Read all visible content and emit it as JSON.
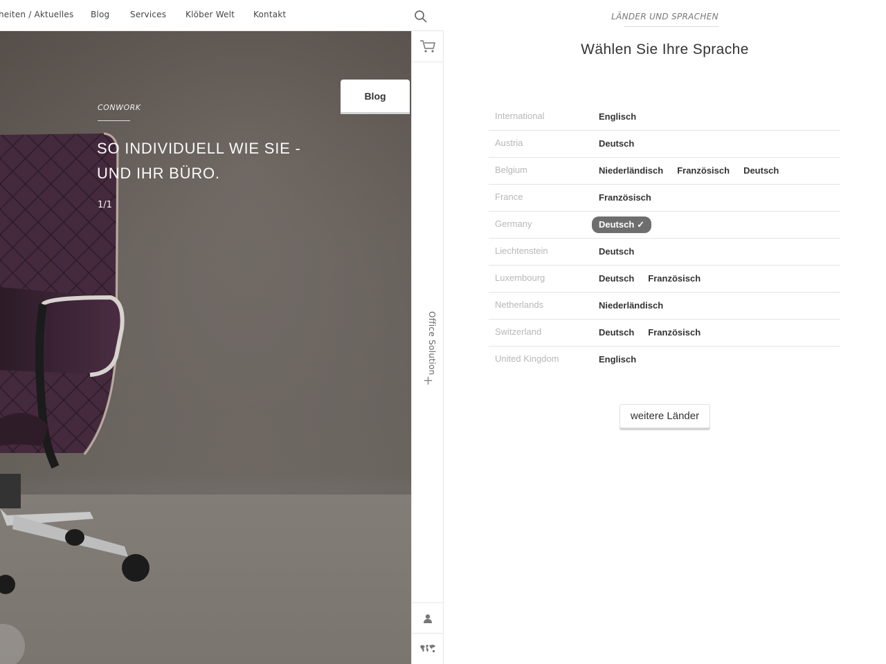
{
  "nav": {
    "items": [
      "heiten / Aktuelles",
      "Blog",
      "Services",
      "Klöber Welt",
      "Kontakt"
    ]
  },
  "hero": {
    "blog_tab": "Blog",
    "kicker": "CONWORK",
    "title": "SO INDIVIDUELL WIE SIE - UND IHR BÜRO.",
    "counter": "1/1"
  },
  "sidebar": {
    "office_solution": "Office Solution"
  },
  "panel": {
    "kicker": "LÄNDER UND SPRACHEN",
    "title": "Wählen Sie Ihre Sprache",
    "rows": [
      {
        "country": "International",
        "languages": [
          {
            "label": "Englisch"
          }
        ]
      },
      {
        "country": "Austria",
        "languages": [
          {
            "label": "Deutsch"
          }
        ]
      },
      {
        "country": "Belgium",
        "languages": [
          {
            "label": "Niederländisch"
          },
          {
            "label": "Französisch"
          },
          {
            "label": "Deutsch"
          }
        ]
      },
      {
        "country": "France",
        "languages": [
          {
            "label": "Französisch"
          }
        ]
      },
      {
        "country": "Germany",
        "languages": [
          {
            "label": "Deutsch",
            "selected": true
          }
        ]
      },
      {
        "country": "Liechtenstein",
        "languages": [
          {
            "label": "Deutsch"
          }
        ]
      },
      {
        "country": "Luxembourg",
        "languages": [
          {
            "label": "Deutsch"
          },
          {
            "label": "Französisch"
          }
        ]
      },
      {
        "country": "Netherlands",
        "languages": [
          {
            "label": "Niederländisch"
          }
        ]
      },
      {
        "country": "Switzerland",
        "languages": [
          {
            "label": "Deutsch"
          },
          {
            "label": "Französisch"
          }
        ]
      },
      {
        "country": "United Kingdom",
        "languages": [
          {
            "label": "Englisch"
          }
        ]
      }
    ],
    "more_button": "weitere Länder"
  },
  "icons": {
    "search": "search-icon",
    "cart": "cart-icon",
    "user": "user-icon",
    "world": "world-map-icon",
    "check": "checkmark-icon"
  }
}
